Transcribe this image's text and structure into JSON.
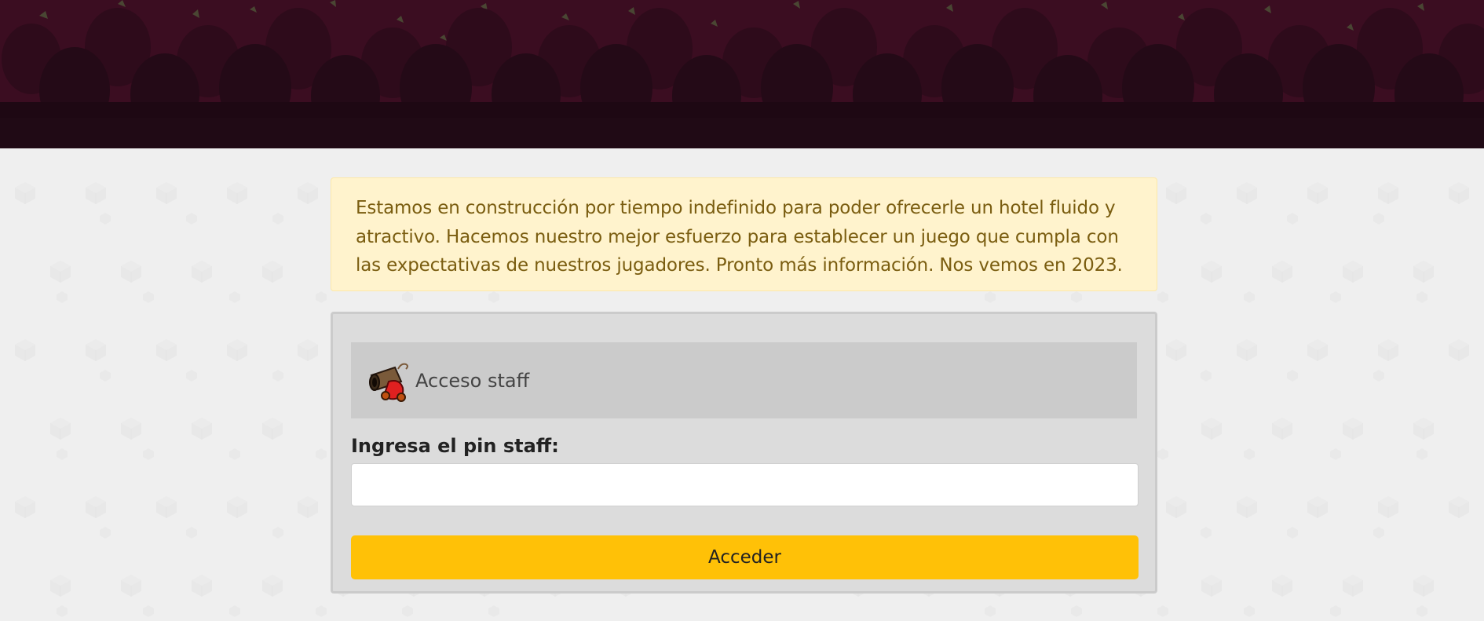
{
  "notice": {
    "text": "Estamos en construcción por tiempo indefinido para poder ofrecerle un hotel fluido y atractivo. Hacemos nuestro mejor esfuerzo para establecer un juego que cumpla con las expectativas de nuestros jugadores. Pronto más información. Nos vemos en 2023."
  },
  "login_panel": {
    "title": "Acceso staff",
    "icon": "cannon-icon",
    "pin_label": "Ingresa el pin staff:",
    "pin_value": "",
    "pin_placeholder": "",
    "submit_label": "Acceder"
  },
  "colors": {
    "banner": "#3a0c20",
    "notice_bg": "#fff3cd",
    "notice_text": "#7a5d10",
    "panel_bg": "#dcdcdc",
    "panel_header_bg": "#cbcbcb",
    "button": "#ffc107",
    "page_bg": "#efefef"
  }
}
